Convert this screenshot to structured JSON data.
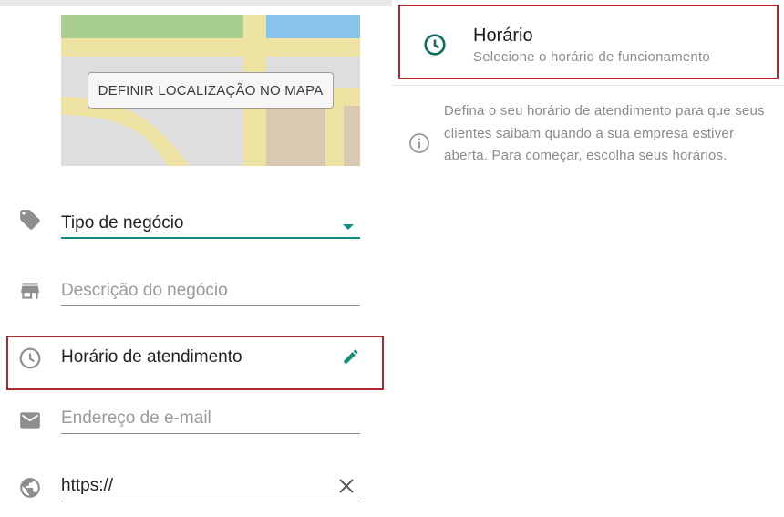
{
  "left": {
    "map_button": "DEFINIR LOCALIZAÇÃO NO MAPA",
    "fields": {
      "business_type": {
        "value": "Tipo de negócio",
        "icon": "tag-icon"
      },
      "description": {
        "placeholder": "Descrição do negócio",
        "icon": "store-icon"
      },
      "hours": {
        "value": "Horário de atendimento",
        "icon": "clock-icon",
        "action_icon": "edit-pencil-icon"
      },
      "email": {
        "placeholder": "Endereço de e-mail",
        "icon": "mail-icon"
      },
      "website": {
        "value": "https://",
        "icon": "globe-icon",
        "action_icon": "clear-x-icon"
      }
    }
  },
  "right": {
    "hours_card": {
      "title": "Horário",
      "subtitle": "Selecione o horário de funcionamento",
      "icon": "clock-icon"
    },
    "info": {
      "icon": "info-icon",
      "text": "Defina o seu horário de atendimento para que seus clientes saibam quando a sua empresa estiver aberta. Para começar, escolha seus horários."
    }
  },
  "colors": {
    "accent_teal": "#128c7e",
    "highlight_red": "#b3262e",
    "icon_gray": "#8e8e8e"
  }
}
